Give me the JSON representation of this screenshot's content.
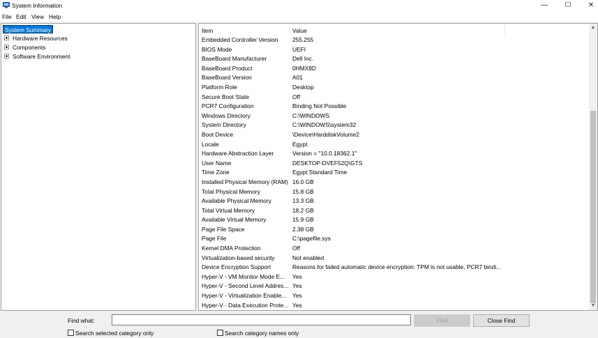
{
  "window": {
    "title": "System Information",
    "minimize_symbol": "—",
    "maximize_symbol": "☐",
    "close_symbol": "✕"
  },
  "menu": [
    "File",
    "Edit",
    "View",
    "Help"
  ],
  "tree": {
    "selected": "System Summary",
    "children": [
      "Hardware Resources",
      "Components",
      "Software Environment"
    ]
  },
  "list": {
    "headers": {
      "item": "Item",
      "value": "Value"
    },
    "rows": [
      {
        "item": "Embedded Controller Version",
        "value": "255.255"
      },
      {
        "item": "BIOS Mode",
        "value": "UEFI"
      },
      {
        "item": "BaseBoard Manufacturer",
        "value": "Dell Inc."
      },
      {
        "item": "BaseBoard Product",
        "value": "0HMX8D"
      },
      {
        "item": "BaseBoard Version",
        "value": "A01"
      },
      {
        "item": "Platform Role",
        "value": "Desktop"
      },
      {
        "item": "Secure Boot State",
        "value": "Off"
      },
      {
        "item": "PCR7 Configuration",
        "value": "Binding Not Possible"
      },
      {
        "item": "Windows Directory",
        "value": "C:\\WINDOWS"
      },
      {
        "item": "System Directory",
        "value": "C:\\WINDOWS\\system32"
      },
      {
        "item": "Boot Device",
        "value": "\\Device\\HarddiskVolume2"
      },
      {
        "item": "Locale",
        "value": "Egypt"
      },
      {
        "item": "Hardware Abstraction Layer",
        "value": "Version = \"10.0.18362.1\""
      },
      {
        "item": "User Name",
        "value": "DESKTOP-DVEF52Q\\GTS"
      },
      {
        "item": "Time Zone",
        "value": "Egypt Standard Time"
      },
      {
        "item": "Installed Physical Memory (RAM)",
        "value": "16.0 GB"
      },
      {
        "item": "Total Physical Memory",
        "value": "15.8 GB"
      },
      {
        "item": "Available Physical Memory",
        "value": "13.3 GB"
      },
      {
        "item": "Total Virtual Memory",
        "value": "18.2 GB"
      },
      {
        "item": "Available Virtual Memory",
        "value": "15.9 GB"
      },
      {
        "item": "Page File Space",
        "value": "2.38 GB"
      },
      {
        "item": "Page File",
        "value": "C:\\pagefile.sys"
      },
      {
        "item": "Kernel DMA Protection",
        "value": "Off"
      },
      {
        "item": "Virtualization-based security",
        "value": "Not enabled"
      },
      {
        "item": "Device Encryption Support",
        "value": "Reasons for failed automatic device encryption: TPM is not usable, PCR7 bindi..."
      },
      {
        "item": "Hyper-V - VM Monitor Mode E...",
        "value": "Yes"
      },
      {
        "item": "Hyper-V - Second Level Addres...",
        "value": "Yes"
      },
      {
        "item": "Hyper-V - Virtualization Enable...",
        "value": "Yes"
      },
      {
        "item": "Hyper-V - Data Execution Prote...",
        "value": "Yes"
      }
    ]
  },
  "find": {
    "label": "Find what:",
    "value": "",
    "find_button": "Find",
    "close_button": "Close Find",
    "search_selected_label": "Search selected category only",
    "search_selected_checked": false,
    "search_names_label": "Search category names only",
    "search_names_checked": false
  }
}
